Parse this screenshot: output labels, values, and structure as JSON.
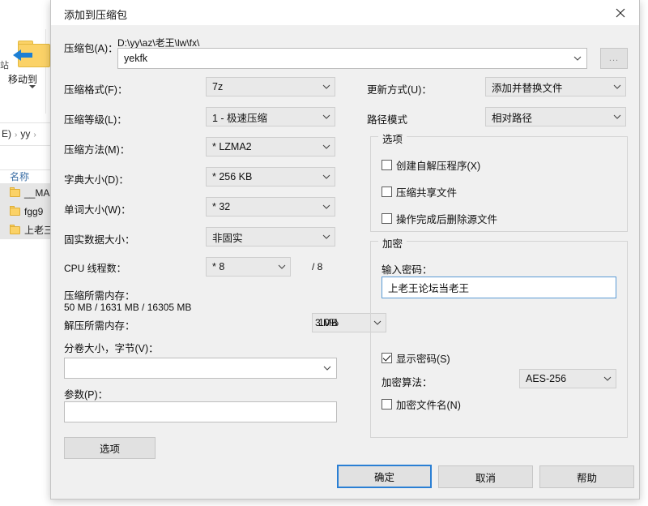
{
  "background": {
    "ribbon": {
      "move_to_label": "移动到",
      "tiny_label": "站",
      "folder_icon": "folder-move-icon"
    },
    "breadcrumb": {
      "parts": [
        "E)",
        "yy"
      ],
      "separator": "›"
    },
    "column_header": "名称",
    "rows": [
      {
        "name": "__MA"
      },
      {
        "name": "fgg9"
      },
      {
        "name": "上老三"
      }
    ]
  },
  "dialog": {
    "title": "添加到压缩包",
    "close_icon": "close-icon",
    "archive": {
      "label": "压缩包(A)：",
      "path": "D:\\yy\\az\\老王\\lw\\fx\\",
      "name": "yekfk",
      "browse_label": "...",
      "dropdown_icon": "chevron-down-icon"
    },
    "left_fields": [
      {
        "label": "压缩格式(F)：",
        "value": "7z"
      },
      {
        "label": "压缩等级(L)：",
        "value": "1 - 极速压缩"
      },
      {
        "label": "压缩方法(M)：",
        "value": "* LZMA2"
      },
      {
        "label": "字典大小(D)：",
        "value": "* 256 KB"
      },
      {
        "label": "单词大小(W)：",
        "value": "* 32"
      },
      {
        "label": "固实数据大小：",
        "value": "非固实"
      }
    ],
    "cpu": {
      "label": "CPU 线程数：",
      "value": "* 8",
      "total": "/ 8"
    },
    "memory_compress": {
      "label": "压缩所需内存：",
      "value": "50 MB / 1631 MB / 16305 MB",
      "percent": "10%"
    },
    "memory_decompress": {
      "label": "解压所需内存：",
      "value": "3 MB"
    },
    "split": {
      "label": "分卷大小，字节(V)：",
      "value": ""
    },
    "params": {
      "label": "参数(P)：",
      "value": ""
    },
    "options_button": "选项",
    "right_fields": [
      {
        "label": "更新方式(U)：",
        "value": "添加并替换文件"
      },
      {
        "label": "路径模式",
        "value": "相对路径"
      }
    ],
    "options_group": {
      "title": "选项",
      "checkboxes": [
        {
          "label": "创建自解压程序(X)",
          "checked": false
        },
        {
          "label": "压缩共享文件",
          "checked": false
        },
        {
          "label": "操作完成后删除源文件",
          "checked": false
        }
      ]
    },
    "encryption_group": {
      "title": "加密",
      "password_label": "输入密码：",
      "password_value": "上老王论坛当老王",
      "show_password": {
        "label": "显示密码(S)",
        "checked": true
      },
      "algorithm_label": "加密算法：",
      "algorithm_value": "AES-256",
      "encrypt_filenames": {
        "label": "加密文件名(N)",
        "checked": false
      }
    },
    "footer": {
      "ok": "确定",
      "cancel": "取消",
      "help": "帮助"
    }
  },
  "colors": {
    "accent": "#2a7fd4",
    "dialog_bg": "#f0f0f0",
    "field_bg": "#e9e9e9",
    "folder_yellow": "#fbd267",
    "link_blue": "#3a6ea5"
  }
}
